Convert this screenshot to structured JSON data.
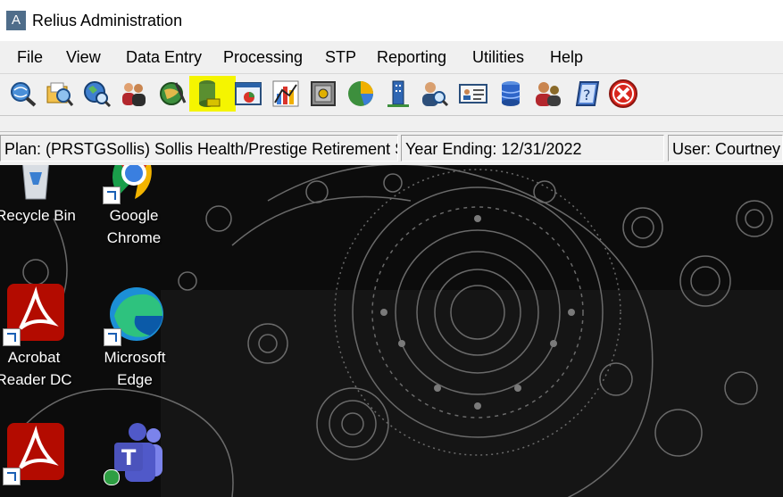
{
  "window": {
    "app_icon_letter": "A",
    "title": "Relius Administration"
  },
  "menu": [
    "File",
    "View",
    "Data Entry",
    "Processing",
    "STP",
    "Reporting",
    "Utilities",
    "Help"
  ],
  "toolbar_icons": [
    "search-globe-icon",
    "folder-search-icon",
    "globe-search-icon",
    "people-icon",
    "globe-edit-icon",
    "database-highlighted-icon",
    "window-chart-icon",
    "bar-chart-icon",
    "safe-icon",
    "pie-chart-icon",
    "building-icon",
    "user-search-icon",
    "id-card-icon",
    "database-icon",
    "user-key-icon",
    "notebook-icon",
    "exit-icon"
  ],
  "status": {
    "plan": "Plan: (PRSTGSollis) Sollis Health/Prestige Retirement Sav",
    "year": "Year Ending: 12/31/2022",
    "user": "User: Courtney J"
  },
  "desktop": {
    "icons": [
      {
        "name": "recycle-bin-icon",
        "line1": "Recycle Bin",
        "line2": ""
      },
      {
        "name": "google-chrome-icon",
        "line1": "Google",
        "line2": "Chrome"
      },
      {
        "name": "acrobat-reader-icon",
        "line1": "Acrobat",
        "line2": "Reader DC"
      },
      {
        "name": "microsoft-edge-icon",
        "line1": "Microsoft",
        "line2": "Edge"
      },
      {
        "name": "acrobat-icon-2",
        "line1": "",
        "line2": ""
      },
      {
        "name": "teams-icon",
        "line1": "",
        "line2": ""
      }
    ]
  },
  "colors": {
    "highlight": "#f5f500",
    "chrome_frame": "#f0f0f0",
    "acrobat_red": "#b30b00",
    "exit_red": "#d9261c"
  }
}
